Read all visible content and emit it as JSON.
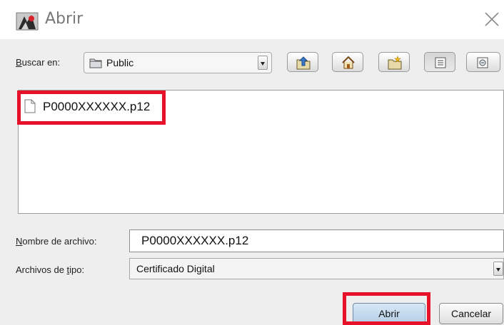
{
  "window": {
    "title": "Abrir",
    "icon": "java-duke-icon",
    "close_icon": "close-x-icon"
  },
  "look_in": {
    "label_prefix": "",
    "label_mnemonic": "B",
    "label_rest": "uscar en:",
    "selected": "Public",
    "folder_icon": "folder-icon"
  },
  "toolbar": {
    "buttons": [
      {
        "name": "up-one-level-button",
        "icon": "folder-up-icon"
      },
      {
        "name": "home-button",
        "icon": "home-icon"
      },
      {
        "name": "new-folder-button",
        "icon": "new-folder-icon"
      },
      {
        "name": "list-view-button",
        "icon": "list-view-icon",
        "pressed": true
      },
      {
        "name": "details-view-button",
        "icon": "details-view-icon"
      }
    ]
  },
  "files": [
    {
      "name": "P0000XXXXXX.p12",
      "icon": "file-icon"
    }
  ],
  "file_name": {
    "label_mnemonic": "N",
    "label_rest": "ombre de archivo:",
    "value": "P0000XXXXXX.p12"
  },
  "file_type": {
    "label_prefix": "Archivos de ",
    "label_mnemonic": "t",
    "label_rest": "ipo:",
    "selected": "Certificado Digital"
  },
  "buttons": {
    "open": "Abrir",
    "cancel": "Cancelar"
  },
  "colors": {
    "highlight": "#e8112a",
    "dialog_background": "#eeeeee",
    "primary_button": "#b3cde6"
  }
}
